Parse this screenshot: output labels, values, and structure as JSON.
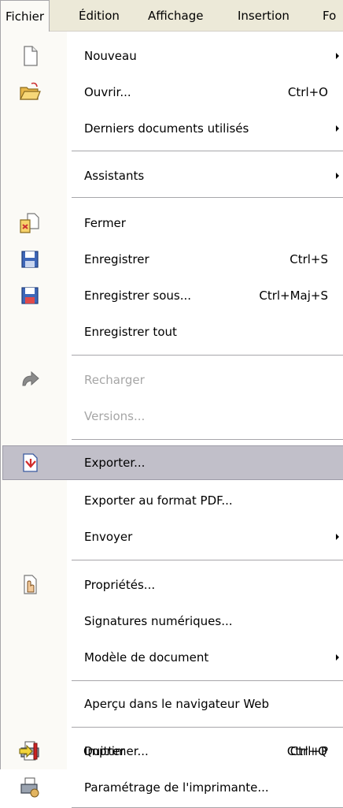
{
  "menubar": {
    "items": [
      {
        "label": "Fichier",
        "active": true
      },
      {
        "label": "Édition"
      },
      {
        "label": "Affichage"
      },
      {
        "label": "Insertion"
      },
      {
        "label": "Fo"
      }
    ]
  },
  "menu": {
    "items": [
      {
        "label": "Nouveau",
        "icon": "new-document-icon",
        "submenu": true
      },
      {
        "label": "Ouvrir...",
        "icon": "open-folder-icon",
        "shortcut": "Ctrl+O"
      },
      {
        "label": "Derniers documents utilisés",
        "submenu": true
      },
      {
        "label": "Assistants",
        "submenu": true
      },
      {
        "label": "Fermer",
        "icon": "close-document-icon"
      },
      {
        "label": "Enregistrer",
        "icon": "save-icon",
        "shortcut": "Ctrl+S"
      },
      {
        "label": "Enregistrer sous...",
        "icon": "save-as-icon",
        "shortcut": "Ctrl+Maj+S"
      },
      {
        "label": "Enregistrer tout"
      },
      {
        "label": "Recharger",
        "icon": "reload-icon",
        "disabled": true
      },
      {
        "label": "Versions...",
        "disabled": true
      },
      {
        "label": "Exporter...",
        "icon": "export-icon",
        "highlighted": true
      },
      {
        "label": "Exporter au format PDF..."
      },
      {
        "label": "Envoyer",
        "submenu": true
      },
      {
        "label": "Propriétés...",
        "icon": "properties-icon"
      },
      {
        "label": "Signatures numériques..."
      },
      {
        "label": "Modèle de document",
        "submenu": true
      },
      {
        "label": "Aperçu dans le navigateur Web"
      },
      {
        "label": "Imprimer...",
        "icon": "printer-icon",
        "shortcut": "Ctrl+P"
      },
      {
        "label": "Paramétrage de l'imprimante...",
        "icon": "printer-settings-icon"
      },
      {
        "label": "Quitter",
        "icon": "exit-icon",
        "shortcut": "Ctrl+Q"
      }
    ]
  }
}
